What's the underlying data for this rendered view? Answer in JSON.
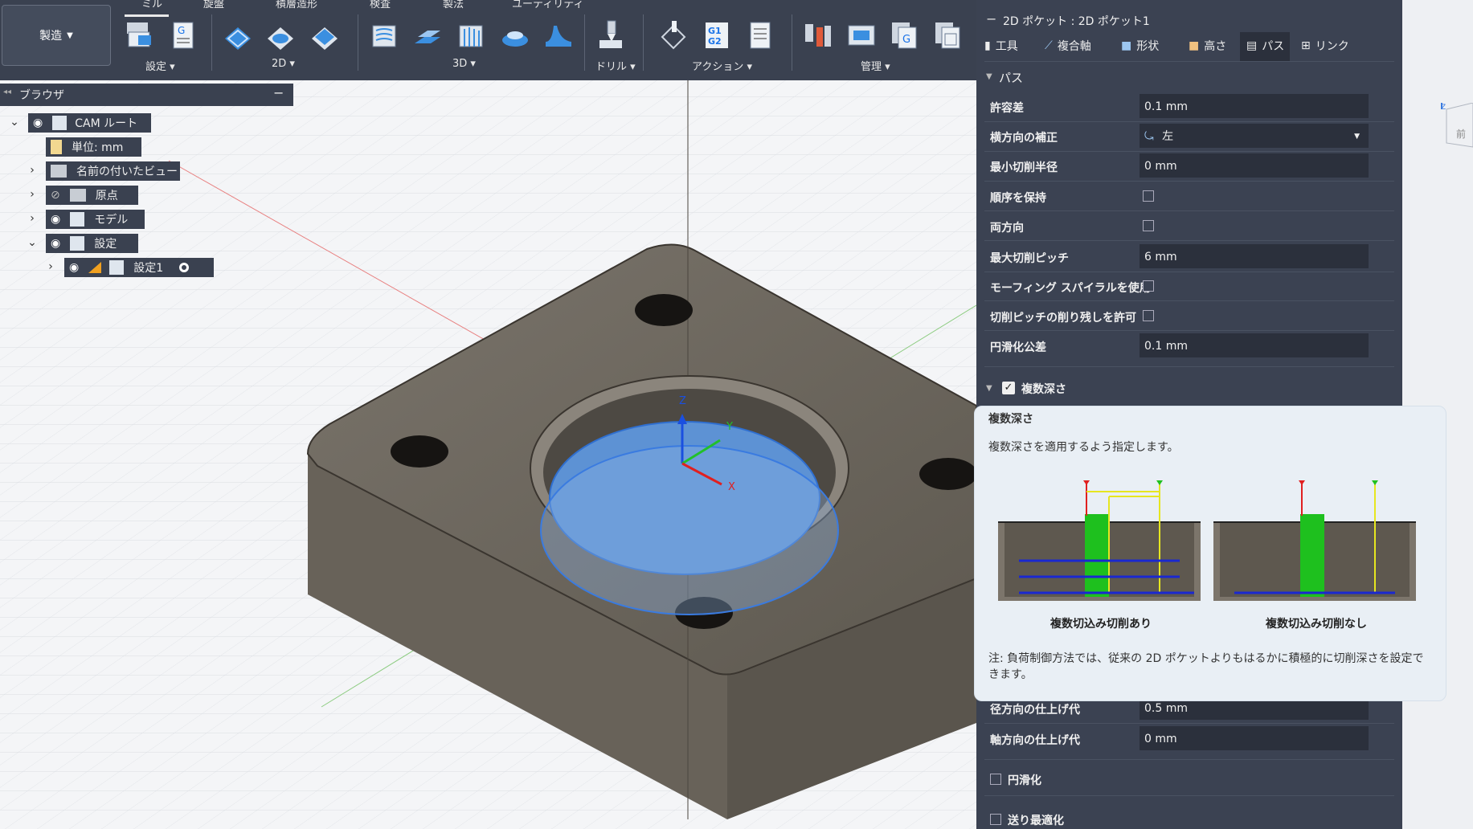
{
  "toolbar": {
    "tabs": [
      "ミル",
      "旋盤",
      "積層造形",
      "検査",
      "製法",
      "ユーティリティ"
    ],
    "workspace": "製造",
    "groups": [
      "設定",
      "2D",
      "3D",
      "ドリル",
      "アクション",
      "管理"
    ]
  },
  "browser": {
    "title": "ブラウザ",
    "nodes": {
      "root": "CAM ルート",
      "units": "単位: mm",
      "named_views": "名前の付いたビュー",
      "origin": "原点",
      "model": "モデル",
      "setups": "設定",
      "setup1": "設定1"
    }
  },
  "viewport": {
    "axes": {
      "x": "X",
      "y": "Y",
      "z": "Z"
    },
    "viewcube_face": "前"
  },
  "panel": {
    "title": "2D ポケット : 2D ポケット1",
    "tabs": [
      "工具",
      "複合軸",
      "形状",
      "高さ",
      "パス",
      "リンク"
    ],
    "section_pass": "パス",
    "rows": [
      {
        "label": "許容差",
        "value": "0.1 mm"
      },
      {
        "label": "横方向の補正",
        "value": "左"
      },
      {
        "label": "最小切削半径",
        "value": "0 mm"
      },
      {
        "label": "順序を保持",
        "value": ""
      },
      {
        "label": "両方向",
        "value": ""
      },
      {
        "label": "最大切削ピッチ",
        "value": "6 mm"
      },
      {
        "label": "モーフィング スパイラルを使用",
        "value": ""
      },
      {
        "label": "切削ピッチの削り残しを許可",
        "value": ""
      },
      {
        "label": "円滑化公差",
        "value": "0.1 mm"
      }
    ],
    "multi_depth": "複数深さ",
    "finish_rows": [
      {
        "label": "径方向の仕上げ代",
        "value": "0.5 mm"
      },
      {
        "label": "軸方向の仕上げ代",
        "value": "0 mm"
      }
    ],
    "smoothing": "円滑化",
    "feed_opt": "送り最適化"
  },
  "tooltip": {
    "title": "複数深さ",
    "desc": "複数深さを適用するよう指定します。",
    "cap_with": "複数切込み切削あり",
    "cap_without": "複数切込み切削なし",
    "note": "注: 負荷制御方法では、従来の 2D ポケットよりもはるかに積極的に切削深さを設定できます。"
  },
  "colors": {
    "toolbar": "#3a4150",
    "panel": "#3b4252",
    "accent_blue": "#1a73e8",
    "part": "#706a62"
  }
}
